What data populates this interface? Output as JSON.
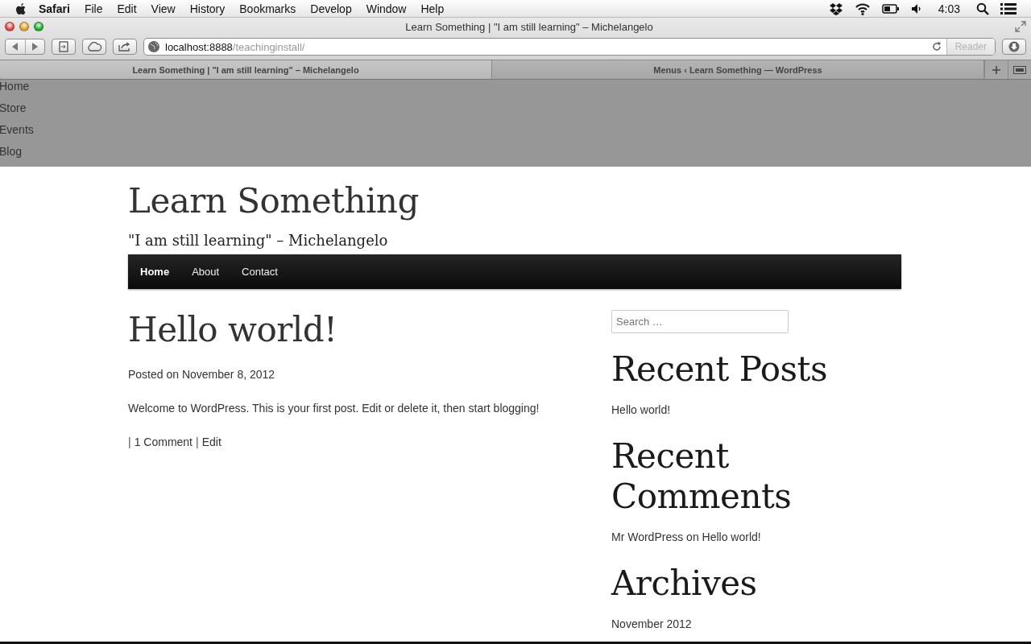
{
  "menubar": {
    "app": "Safari",
    "menus": [
      "File",
      "Edit",
      "View",
      "History",
      "Bookmarks",
      "Develop",
      "Window",
      "Help"
    ],
    "clock": "4:03"
  },
  "window": {
    "title": "Learn Something | \"I am still learning\" – Michelangelo"
  },
  "toolbar": {
    "url_host": "localhost:8888",
    "url_path": "/teachinginstall/",
    "reader": "Reader"
  },
  "tabs": [
    {
      "label": "Learn Something | \"I am still learning\" – Michelangelo",
      "selected": true
    },
    {
      "label": "Menus ‹ Learn Something — WordPress",
      "selected": false
    }
  ],
  "page": {
    "top_menu": [
      "Home",
      "Store",
      "Events",
      "Blog"
    ],
    "site_title": "Learn Something",
    "tagline": "\"I am still learning\" – Michelangelo",
    "nav": [
      {
        "label": "Home",
        "selected": true
      },
      {
        "label": "About",
        "selected": false
      },
      {
        "label": "Contact",
        "selected": false
      }
    ],
    "post": {
      "title": "Hello world!",
      "meta_prefix": "Posted on",
      "date": "November 8, 2012",
      "body": "Welcome to WordPress. This is your first post. Edit or delete it, then start blogging!",
      "footer": [
        {
          "kind": "sep",
          "text": "|"
        },
        {
          "kind": "link",
          "text": "1 Comment"
        },
        {
          "kind": "sep",
          "text": "|"
        },
        {
          "kind": "link",
          "text": "Edit"
        }
      ]
    },
    "sidebar": {
      "search": {
        "placeholder": "Search …"
      },
      "widgets": [
        {
          "title": "Recent Posts",
          "kind": "links",
          "items": [
            "Hello world!"
          ]
        },
        {
          "title": "Recent Comments",
          "kind": "comments",
          "items": [
            {
              "author": "Mr WordPress",
              "joiner": "on",
              "post": "Hello world!"
            }
          ]
        },
        {
          "title": "Archives",
          "kind": "links",
          "items": [
            "November 2012"
          ]
        }
      ]
    }
  }
}
